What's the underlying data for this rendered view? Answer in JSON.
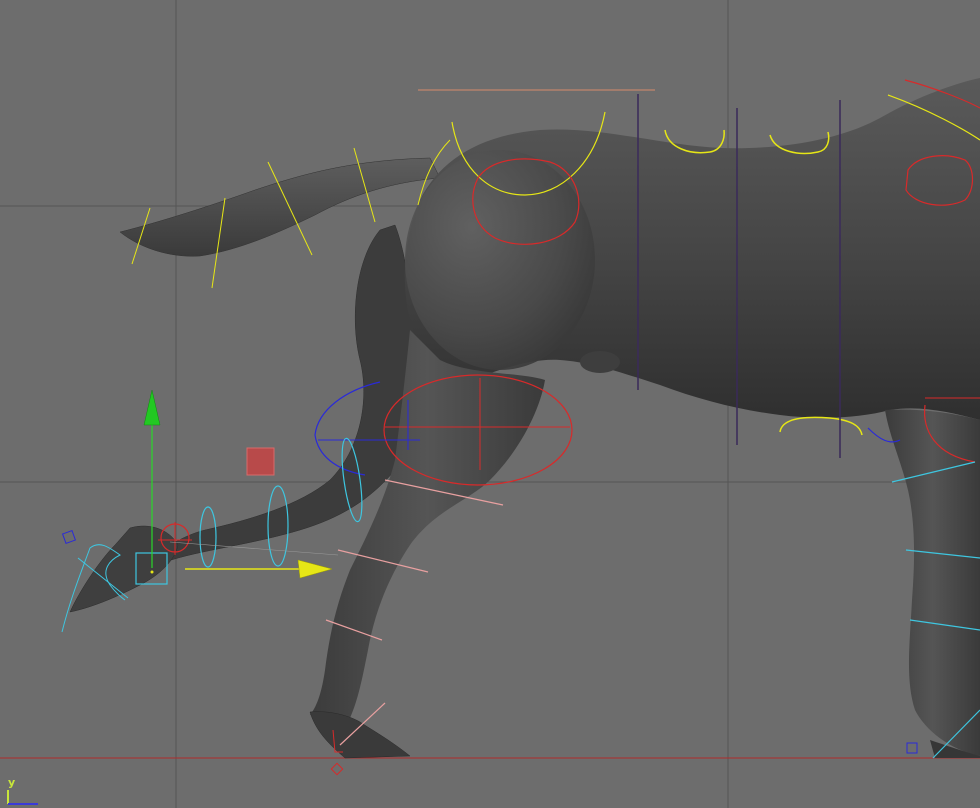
{
  "viewport": {
    "background": "#6d6d6d",
    "grid_color": "#555555",
    "ground_color": "#b02a2a"
  },
  "colors": {
    "mesh": "#4b4b4b",
    "mesh_shadow": "#3a3a3a",
    "mesh_light": "#767676",
    "control_yellow": "#e6e616",
    "control_red": "#d82a2a",
    "control_blue": "#2a2ad8",
    "control_cyan": "#3ec6e0",
    "control_pink": "#e8a0a0",
    "control_purple": "#3a2a5a",
    "control_green": "#2ad82a",
    "manip_box": "#b84a4a"
  },
  "axis_indicator": {
    "y_label": "y",
    "y_color": "#c8e63a",
    "x_color": "#3a3ad8"
  },
  "icons": {
    "move_manipulator": "move-manipulator-icon",
    "axis_indicator": "view-axis-icon"
  }
}
